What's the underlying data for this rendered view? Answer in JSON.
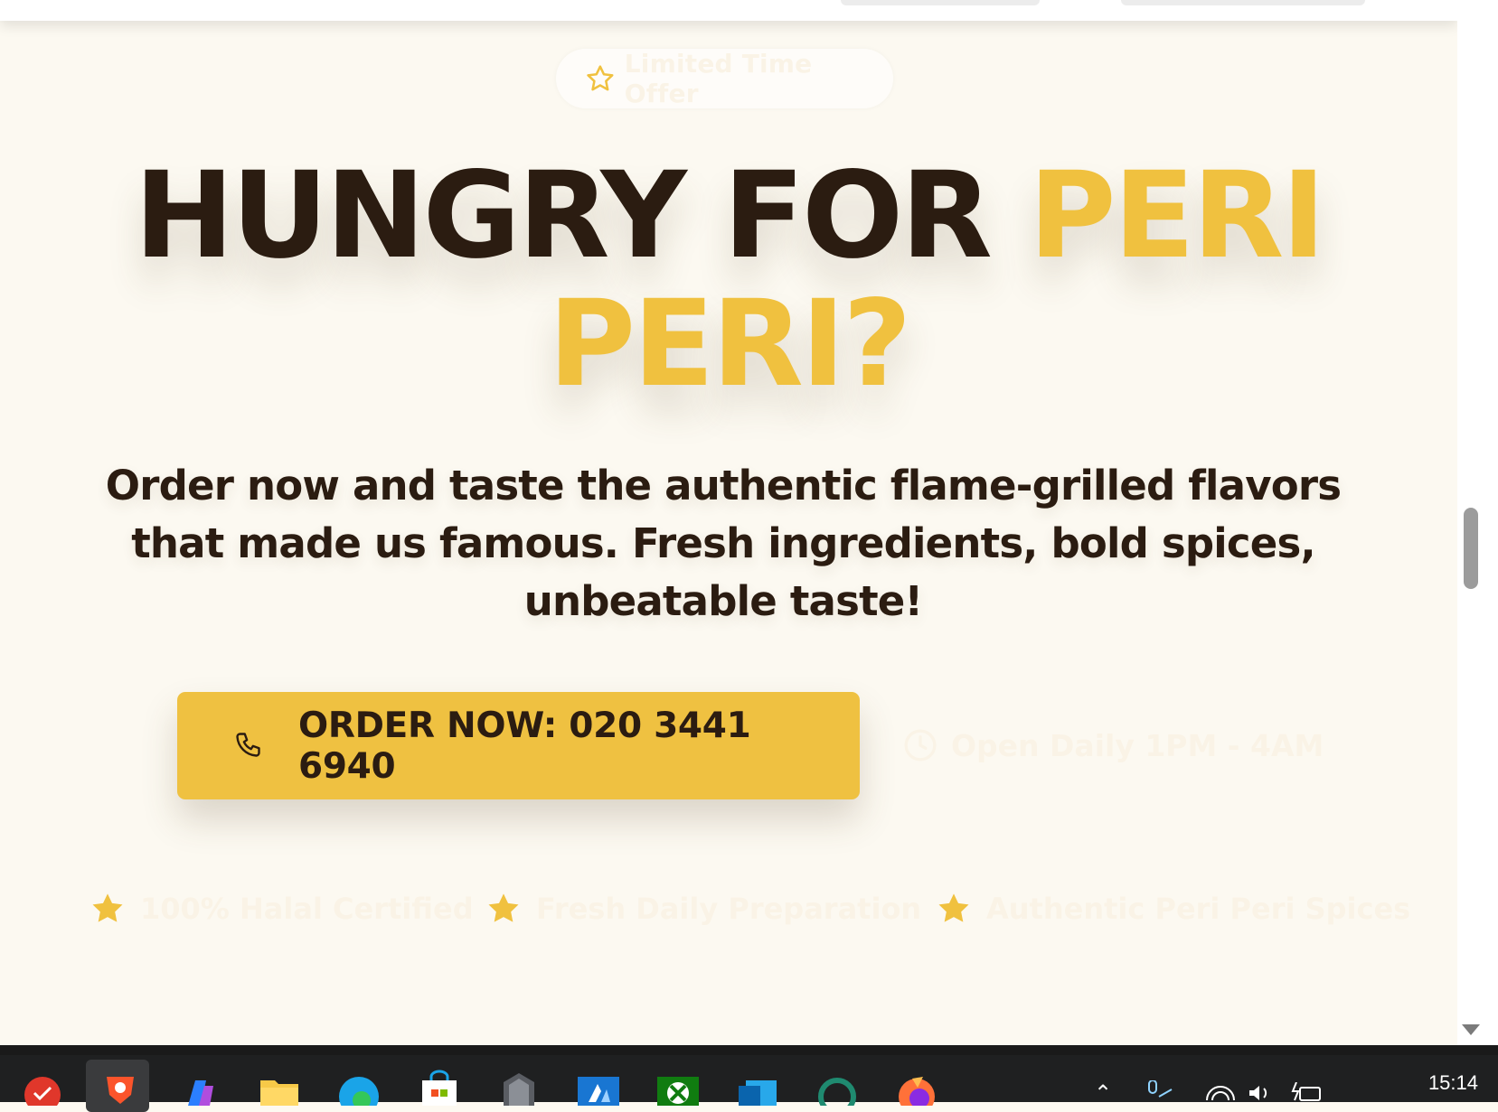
{
  "browser": {
    "scroll_position_fraction": 0.5
  },
  "hero": {
    "badge_label": "Limited Time Offer",
    "headline_part1": "HUNGRY FOR ",
    "headline_accent_line1": "PERI",
    "headline_accent_line2": "PERI?",
    "subtitle": "Order now and taste the authentic flame-grilled flavors that made us famous. Fresh ingredients, bold spices, unbeatable taste!",
    "order_button_label": "ORDER NOW: 020 3441 6940",
    "hours_label": "Open Daily 1PM - 4AM",
    "features": [
      {
        "label": "100% Halal Certified",
        "icon": "star-icon"
      },
      {
        "label": "Fresh Daily Preparation",
        "icon": "star-icon"
      },
      {
        "label": "Authentic Peri Peri Spices",
        "icon": "star-icon"
      }
    ]
  },
  "colors": {
    "background": "#fcf9f1",
    "accent": "#f0c13f",
    "text_dark": "#2b1c11",
    "button": "#efc141"
  },
  "taskbar": {
    "clock": "15:14",
    "pinned_apps": [
      "anydesk-icon",
      "brave-browser-icon",
      "copilot-icon",
      "file-explorer-icon",
      "edge-icon",
      "microsoft-store-icon",
      "security-shield-icon",
      "azure-icon",
      "xbox-icon",
      "outlook-icon",
      "app-ring-icon",
      "firefox-icon"
    ],
    "tray": [
      "chevron-up-icon",
      "microphone-icon",
      "network-icon",
      "volume-icon",
      "battery-icon"
    ]
  }
}
